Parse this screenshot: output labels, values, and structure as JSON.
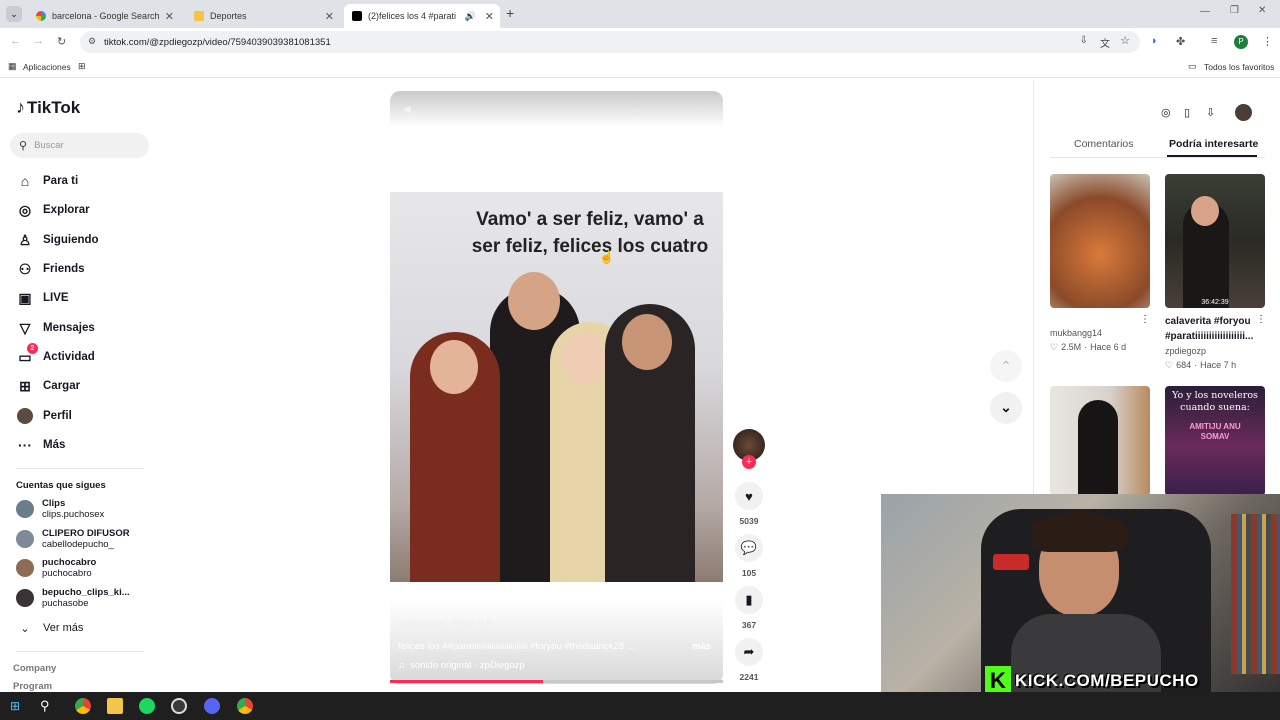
{
  "browser": {
    "tabs": [
      {
        "title": "barcelona - Google Search"
      },
      {
        "title": "Deportes"
      },
      {
        "title": "(2)felices los 4 #parati"
      }
    ],
    "url": "tiktok.com/@zpdiegozp/video/7594039039381081351",
    "bookmarks": {
      "apps": "Aplicaciones",
      "all": "Todos los favoritos"
    },
    "profile_initial": "P"
  },
  "tiktok": {
    "logo": "TikTok",
    "search_placeholder": "Buscar",
    "nav": [
      {
        "label": "Para ti",
        "icon": "home-icon"
      },
      {
        "label": "Explorar",
        "icon": "compass-icon"
      },
      {
        "label": "Siguiendo",
        "icon": "following-icon"
      },
      {
        "label": "Friends",
        "icon": "friends-icon"
      },
      {
        "label": "LIVE",
        "icon": "live-icon"
      },
      {
        "label": "Mensajes",
        "icon": "messages-icon"
      },
      {
        "label": "Actividad",
        "icon": "activity-icon",
        "badge": "2"
      },
      {
        "label": "Cargar",
        "icon": "upload-icon"
      },
      {
        "label": "Perfil",
        "icon": "profile-icon"
      },
      {
        "label": "Más",
        "icon": "more-icon"
      }
    ],
    "following_title": "Cuentas que sigues",
    "following": [
      {
        "name": "Clips",
        "handle": "clips.puchosex"
      },
      {
        "name": "CLIPERO DIFUSOR",
        "handle": "cabellodepucho_"
      },
      {
        "name": "puchocabro",
        "handle": "puchocabro"
      },
      {
        "name": "bepucho_clips_ki...",
        "handle": "puchasobe"
      }
    ],
    "see_more": "Ver más",
    "footer": [
      "Company",
      "Program"
    ]
  },
  "video": {
    "caption_overlay": "Vamo' a ser feliz, vamo' a ser feliz, felices los cuatro",
    "author_line": "zpdiegozp · Hace 9 h",
    "description": "felices los 4#paratiiiiiiiiiiiiiiiiiiiiiiiii #foryou #thedaarick28 ...",
    "more": "más",
    "sound": "sonido original - zpDiegozp",
    "progress": 0.46,
    "stats": {
      "likes": "5039",
      "comments": "105",
      "saves": "367",
      "shares": "2241"
    }
  },
  "right_panel": {
    "tabs": [
      "Comentarios",
      "Podría interesarte"
    ],
    "active_tab": "Podría interesarte",
    "cards": [
      {
        "title": "",
        "user": "mukbangg14",
        "likes": "2.5M",
        "time": "Hace 6 d",
        "duration": ""
      },
      {
        "title": "calaverita #foryou #paratiiiiiiiiiiiiiiiiii...",
        "user": "zpdiegozp",
        "likes": "684",
        "time": "Hace 7 h",
        "duration": "36:42:39"
      },
      {
        "title": "",
        "user": "",
        "likes": "",
        "time": "",
        "duration": ""
      },
      {
        "title": "Yo y los noveleros cuando suena:",
        "user": "",
        "likes": "",
        "time": "",
        "duration": ""
      }
    ],
    "card4_overlay": "AMITIJU ANU SOMAV"
  },
  "webcam": {
    "banner": "KICK.COM/BEPUCHO"
  },
  "colors": {
    "accent": "#fe2c55",
    "kick_green": "#53fc18",
    "taskbar": "#1f1f1f"
  }
}
